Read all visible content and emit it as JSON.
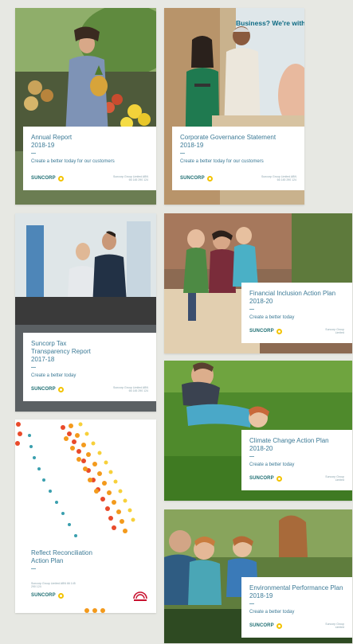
{
  "brand": {
    "logo_text": "SUNCORP",
    "accent": "#f3c300",
    "text_color": "#3c7a96"
  },
  "cards": {
    "annual": {
      "title": "Annual Report",
      "subtitle": "2018-19",
      "tagline": "Create a better today for our customers",
      "fine": "Suncorp Group Limited ABN 66 145 290 124"
    },
    "governance": {
      "title": "Corporate Governance Statement",
      "subtitle": "2018-19",
      "tagline": "Create a better today for our customers",
      "fine": "Suncorp Group Limited ABN 66 145 290 124",
      "sign_text": "Business? We're with"
    },
    "tax": {
      "title": "Suncorp Tax",
      "title2": "Transparency Report",
      "subtitle": "2017-18",
      "tagline": "Create a better today",
      "fine": "Suncorp Group Limited ABN 66 145 290 124"
    },
    "inclusion": {
      "title": "Financial Inclusion Action Plan",
      "subtitle": "2018-20",
      "tagline": "Create a better today",
      "fine": "Suncorp Group Limited"
    },
    "climate": {
      "title": "Climate Change Action Plan",
      "subtitle": "2018-20",
      "tagline": "Create a better today",
      "fine": "Suncorp Group Limited"
    },
    "reconciliation": {
      "title": "Reflect Reconciliation",
      "title2": "Action Plan",
      "fine": "Suncorp Group Limited ABN 66 145 290 124"
    },
    "environment": {
      "title": "Environmental Performance Plan",
      "subtitle": "2018-19",
      "tagline": "Create a better today",
      "fine": "Suncorp Group Limited"
    }
  }
}
